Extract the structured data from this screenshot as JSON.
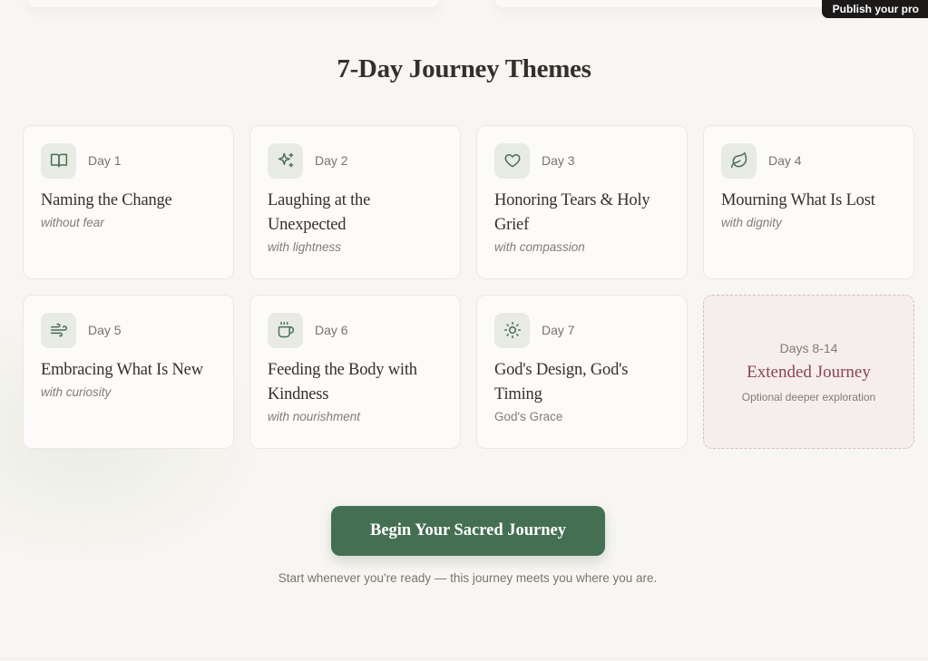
{
  "header": {
    "publish_label": "Publish your pro"
  },
  "section": {
    "title": "7-Day Journey Themes"
  },
  "days": [
    {
      "day": "Day 1",
      "title": "Naming the Change",
      "subtitle": "without fear",
      "icon": "book-open-icon"
    },
    {
      "day": "Day 2",
      "title": "Laughing at the Unexpected",
      "subtitle": "with lightness",
      "icon": "sparkles-icon"
    },
    {
      "day": "Day 3",
      "title": "Honoring Tears & Holy Grief",
      "subtitle": "with compassion",
      "icon": "heart-icon"
    },
    {
      "day": "Day 4",
      "title": "Mourning What Is Lost",
      "subtitle": "with dignity",
      "icon": "leaf-icon"
    },
    {
      "day": "Day 5",
      "title": "Embracing What Is New",
      "subtitle": "with curiosity",
      "icon": "wind-icon"
    },
    {
      "day": "Day 6",
      "title": "Feeding the Body with Kindness",
      "subtitle": "with nourishment",
      "icon": "coffee-cup-icon"
    },
    {
      "day": "Day 7",
      "title": "God's Design, God's Timing",
      "subtitle": "God's Grace",
      "icon": "sun-icon"
    }
  ],
  "extended": {
    "days": "Days 8-14",
    "title": "Extended Journey",
    "subtitle": "Optional deeper exploration"
  },
  "cta": {
    "label": "Begin Your Sacred Journey",
    "note": "Start whenever you're ready — this journey meets you where you are."
  },
  "colors": {
    "accent": "#456f52",
    "extended_accent": "#8c4350",
    "icon_bg": "#e8ebe4",
    "background": "#f8f6f2"
  }
}
